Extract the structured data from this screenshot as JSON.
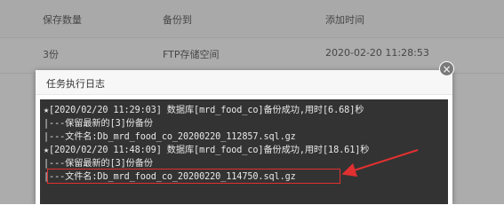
{
  "table": {
    "headers": [
      "保存数量",
      "备份到",
      "添加时间"
    ],
    "row": {
      "count": "3份",
      "target": "FTP存储空间",
      "time": "2020-02-20 11:28:53"
    }
  },
  "dialog": {
    "title": "任务执行日志",
    "close_icon": "close-icon",
    "log_lines": [
      "★[2020/02/20 11:29:03] 数据库[mrd_food_co]备份成功,用时[6.68]秒",
      "|---保留最新的[3]份备份",
      "|---文件名:Db_mrd_food_co_20200220_112857.sql.gz",
      "★[2020/02/20 11:48:09] 数据库[mrd_food_co]备份成功,用时[18.61]秒",
      "|---保留最新的[3]份备份",
      "|---文件名:Db_mrd_food_co_20200220_114750.sql.gz"
    ]
  },
  "colors": {
    "highlight": "#e03030",
    "log_background": "#333333",
    "log_text": "#e8e8e8"
  }
}
